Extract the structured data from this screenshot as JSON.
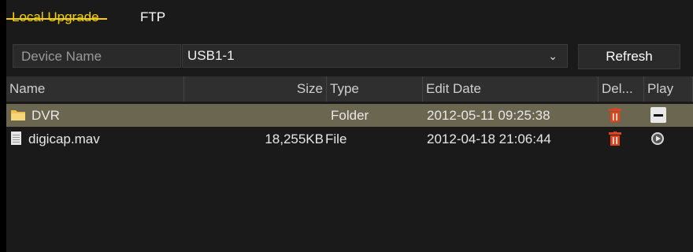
{
  "tabs": {
    "local_upgrade": "Local Upgrade",
    "ftp": "FTP"
  },
  "device": {
    "label": "Device Name",
    "value": "USB1-1",
    "refresh": "Refresh"
  },
  "table": {
    "headers": {
      "name": "Name",
      "size": "Size",
      "type": "Type",
      "edit_date": "Edit Date",
      "delete": "Del...",
      "play": "Play"
    },
    "rows": [
      {
        "name": "DVR",
        "size": "",
        "type": "Folder",
        "edit_date": "2012-05-11 09:25:38",
        "icon": "folder-icon",
        "play_icon": "minus-icon",
        "selected": true
      },
      {
        "name": "digicap.mav",
        "size": "18,255KB",
        "type": "File",
        "edit_date": "2012-04-18 21:06:44",
        "icon": "file-icon",
        "play_icon": "play-icon",
        "selected": false
      }
    ]
  },
  "colors": {
    "accent": "#f5d000",
    "selected_row": "#6b6650",
    "delete_icon": "#e0441a"
  }
}
